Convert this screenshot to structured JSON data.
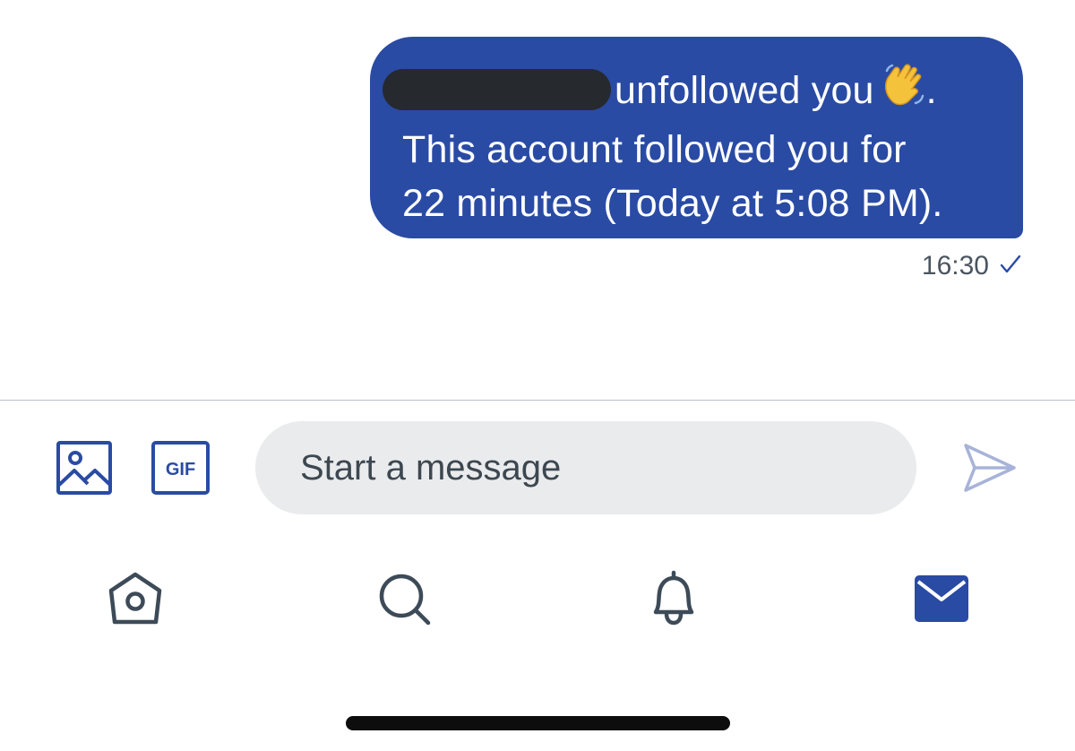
{
  "message": {
    "line1_text": "unfollowed you",
    "line1_end": ".",
    "line2": "This account followed you for",
    "line3": "22 minutes (Today at 5:08 PM).",
    "timestamp": "16:30",
    "bubble_color": "#2a4ba4",
    "status_icon": "check-icon"
  },
  "composer": {
    "placeholder": "Start a message",
    "value": "",
    "gif_label": "GIF",
    "accent_color": "#2a4ba4"
  },
  "tabbar": {
    "items": [
      {
        "name": "home",
        "icon": "home-icon",
        "active": false
      },
      {
        "name": "search",
        "icon": "search-icon",
        "active": false
      },
      {
        "name": "notifications",
        "icon": "bell-icon",
        "active": false
      },
      {
        "name": "messages",
        "icon": "mail-icon",
        "active": true
      }
    ]
  }
}
